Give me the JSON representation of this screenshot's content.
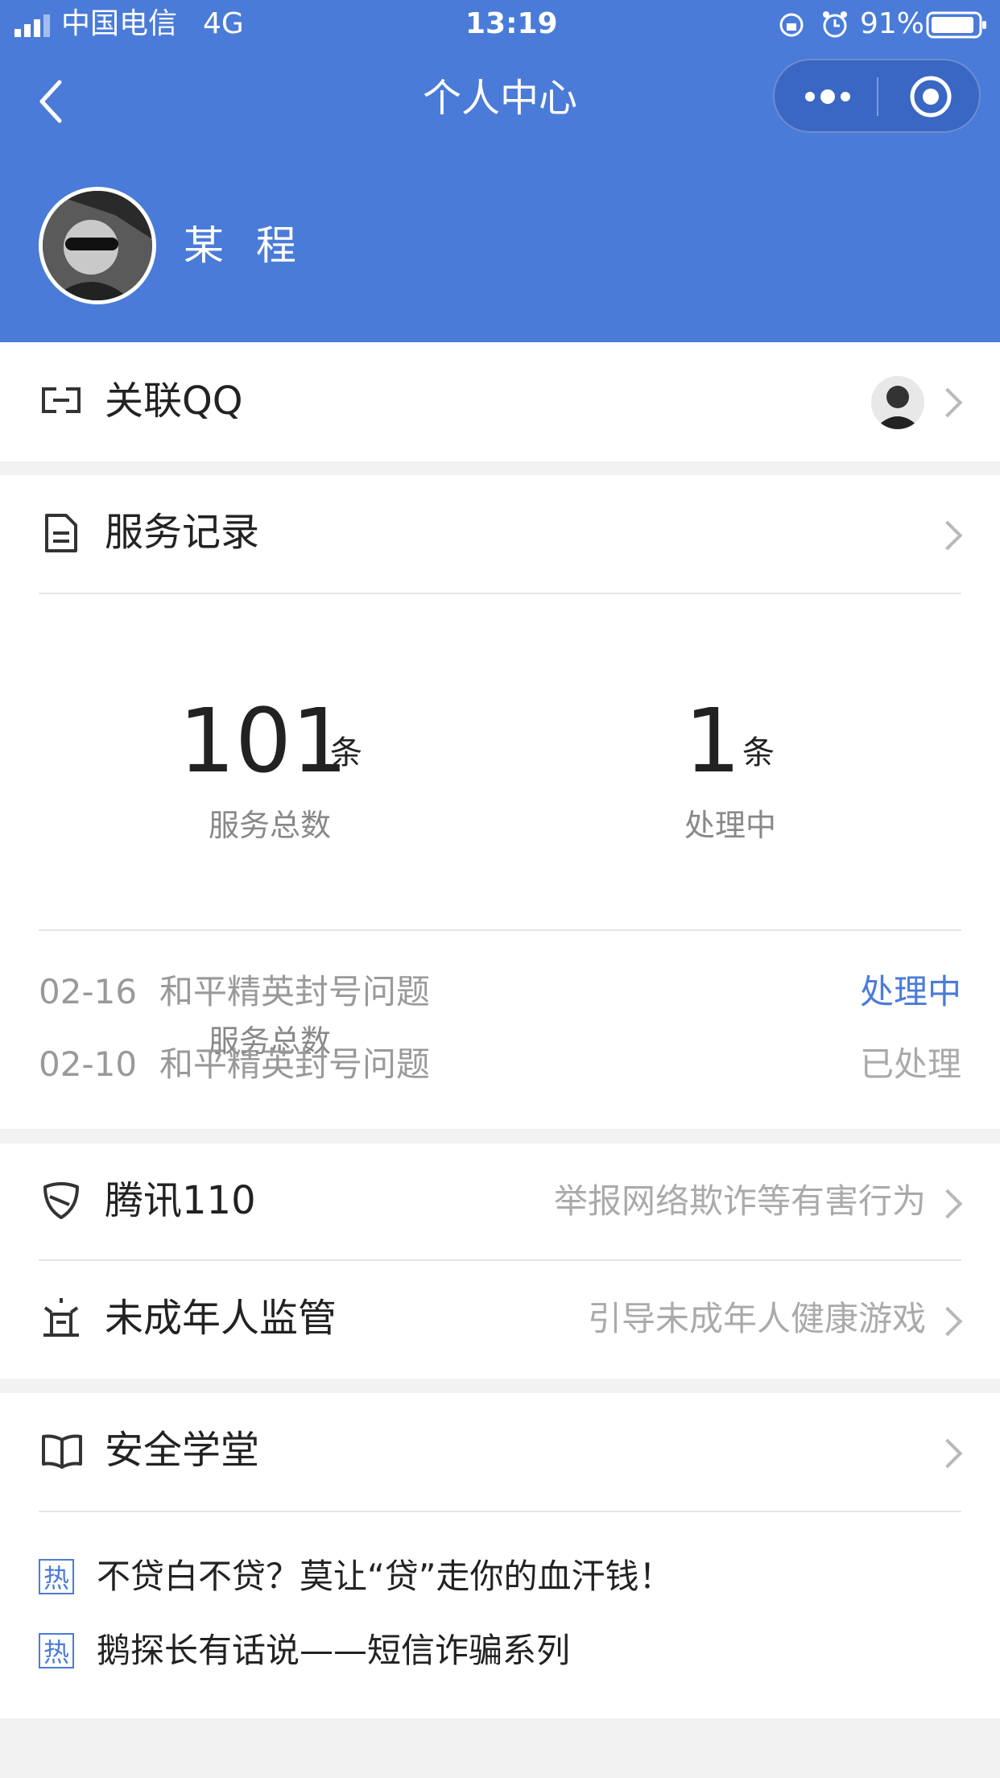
{
  "status_bar": {
    "carrier": "中国电信",
    "network": "4G",
    "time": "13:19",
    "battery": "91%"
  },
  "nav": {
    "title": "个人中心"
  },
  "profile": {
    "name": "某 程"
  },
  "link_qq": {
    "label": "关联QQ"
  },
  "service": {
    "label": "服务记录",
    "stats": [
      {
        "value": "101",
        "unit": "条",
        "label": "服务总数"
      },
      {
        "value": "1",
        "unit": "条",
        "label": "处理中"
      }
    ],
    "records": [
      {
        "date": "02-16",
        "title": "和平精英封号问题",
        "status": "处理中",
        "status_color": "#4a7bd8"
      },
      {
        "date": "02-10",
        "title": "和平精英封号问题",
        "status": "已处理",
        "status_color": "#aaaaaa"
      }
    ]
  },
  "tencent110": {
    "label": "腾讯110",
    "desc": "举报网络欺诈等有害行为"
  },
  "minor": {
    "label": "未成年人监管",
    "desc": "引导未成年人健康游戏"
  },
  "safety": {
    "label": "安全学堂",
    "badge": "热",
    "articles": [
      "不贷白不贷？莫让“贷”走你的血汗钱！",
      "鹅探长有话说——短信诈骗系列"
    ]
  },
  "colors": {
    "brand_blue": "#4a7bd8"
  }
}
